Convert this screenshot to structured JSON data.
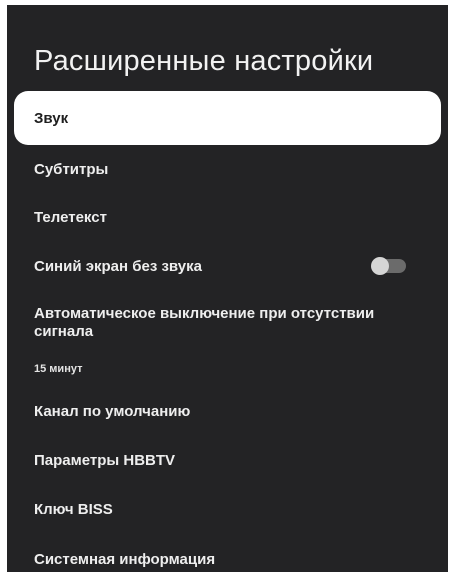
{
  "screen": {
    "title": "Расширенные настройки"
  },
  "menu": {
    "items": [
      {
        "label": "Звук"
      },
      {
        "label": "Субтитры"
      },
      {
        "label": "Телетекст"
      },
      {
        "label": "Синий экран без звука",
        "toggle_on": false
      },
      {
        "label": "Автоматическое выключение при отсутствии сигнала",
        "value": "15 минут"
      },
      {
        "label": "Канал по умолчанию"
      },
      {
        "label": "Параметры HBBTV"
      },
      {
        "label": "Ключ BISS"
      },
      {
        "label": "Системная информация"
      }
    ]
  },
  "colors": {
    "panel_bg": "#232325",
    "focused_bg": "#ffffff",
    "text": "#eeeeee"
  }
}
